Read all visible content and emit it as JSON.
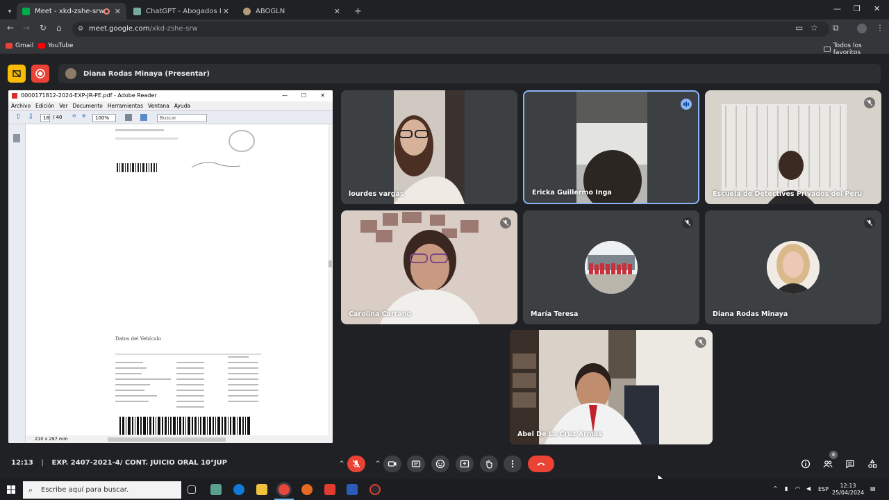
{
  "browser": {
    "tabs": [
      {
        "label": "Meet - xkd-zshe-srw",
        "active": true
      },
      {
        "label": "ChatGPT - Abogados Lima No",
        "active": false
      },
      {
        "label": "ABOGLN",
        "active": false
      }
    ],
    "new_tab": "+",
    "url_host": "meet.google.com",
    "url_path": "/xkd-zshe-srw",
    "bookmarks": [
      {
        "label": "Gmail"
      },
      {
        "label": "YouTube"
      }
    ],
    "all_bookmarks": "Todos los favoritos"
  },
  "meet": {
    "presenter_label": "Diana Rodas Minaya (Presentar)",
    "shared_window": {
      "title": "0000171812-2024-EXP-JR-PE.pdf - Adobe Reader",
      "menu": [
        "Archivo",
        "Edición",
        "Ver",
        "Documento",
        "Herramientas",
        "Ventana",
        "Ayuda"
      ],
      "page_current": "18",
      "page_total": "/ 40",
      "zoom": "100%",
      "search_placeholder": "Buscar",
      "page_size": "210 x 297 mm",
      "doc_heading": "Datos del Vehículo"
    },
    "participants": [
      {
        "name": "lourdes vargas",
        "muted": false,
        "speaking": false
      },
      {
        "name": "Ericka Guillermo Inga",
        "muted": false,
        "speaking": true
      },
      {
        "name": "Escuela de Detectives Privados del Perú",
        "muted": true,
        "speaking": false
      },
      {
        "name": "Carolina Carrano",
        "muted": true,
        "speaking": false
      },
      {
        "name": "María Teresa",
        "muted": true,
        "speaking": false
      },
      {
        "name": "Diana Rodas Minaya",
        "muted": true,
        "speaking": false
      },
      {
        "name": "Abel De La Cruz Armas",
        "muted": true,
        "speaking": false
      }
    ],
    "clock": "12:13",
    "meeting_title": "EXP. 2407-2021-4/ CONT. JUICIO ORAL 10°JUP",
    "people_count": "8",
    "colors": {
      "accent": "#8ab4f8",
      "danger": "#ea4335",
      "surface": "#3c4043",
      "record": "#ea4335",
      "activity": "#fbbc04"
    }
  },
  "taskbar": {
    "search_placeholder": "Escribe aquí para buscar.",
    "lang": "ESP",
    "time": "12:13",
    "date": "25/04/2024"
  }
}
